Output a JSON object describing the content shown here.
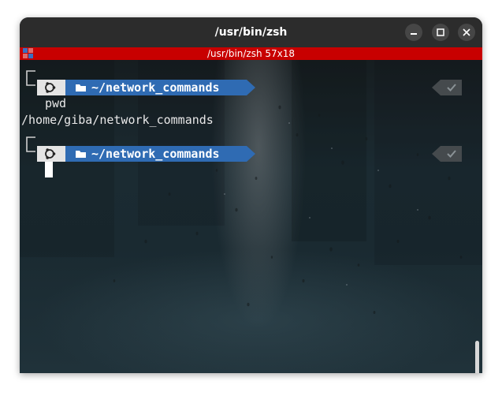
{
  "window": {
    "title": "/usr/bin/zsh",
    "buttons": [
      "minimize",
      "maximize",
      "close"
    ]
  },
  "terminal_header": {
    "title": "/usr/bin/zsh 57x18"
  },
  "terminal": {
    "prompt1": {
      "os_icon": "ubuntu-icon",
      "folder_icon": "folder-icon",
      "dir": "~/network_commands",
      "status_icon": "check-icon"
    },
    "command1": "pwd",
    "output1": "/home/giba/network_commands",
    "prompt2": {
      "os_icon": "ubuntu-icon",
      "folder_icon": "folder-icon",
      "dir": "~/network_commands",
      "status_icon": "check-icon"
    }
  },
  "colors": {
    "header_red": "#c80000",
    "dir_segment": "#2f6bb3",
    "icon_segment": "#e4e4e4",
    "status_segment": "#454a4d"
  }
}
